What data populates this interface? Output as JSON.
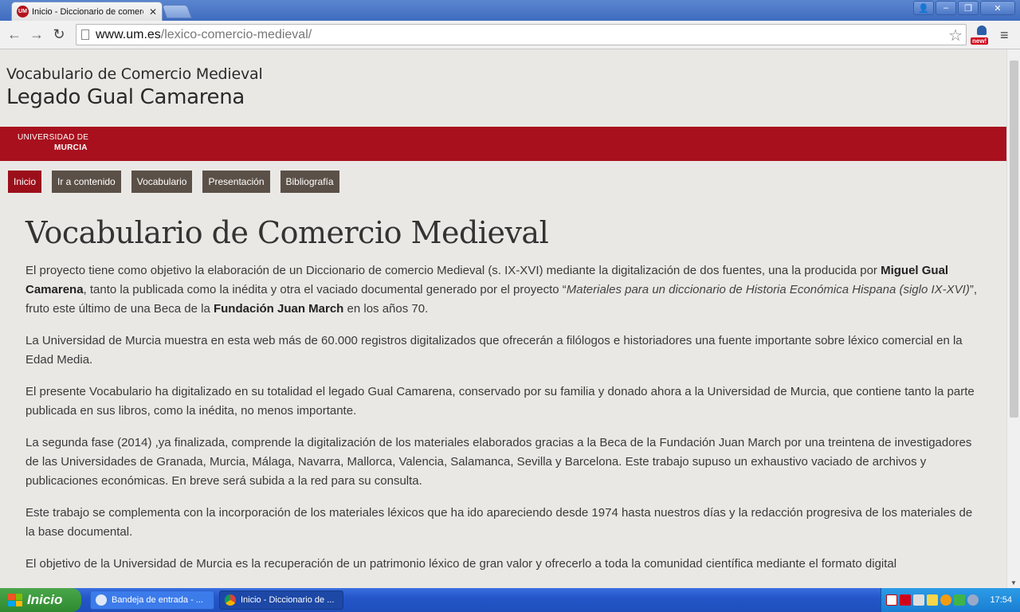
{
  "browser": {
    "tab_title": "Inicio - Diccionario de comerc",
    "tab_favicon": "UM",
    "url_host": "www.um.es",
    "url_path": "/lexico-comercio-medieval/",
    "extension_badge": "new!"
  },
  "site": {
    "subtitle": "Vocabulario de Comercio Medieval",
    "title": "Legado Gual Camarena",
    "logo_line1": "UNIVERSIDAD DE",
    "logo_line2": "MURCIA",
    "accent_color": "#a8101e"
  },
  "menu": [
    {
      "label": "Inicio",
      "active": true
    },
    {
      "label": "Ir a contenido"
    },
    {
      "label": "Vocabulario"
    },
    {
      "label": "Presentación"
    },
    {
      "label": "Bibliografía"
    }
  ],
  "content": {
    "heading": "Vocabulario de Comercio Medieval",
    "p1": {
      "a": "El proyecto tiene como objetivo la elaboración de un Diccionario de comercio Medieval (s. IX-XVI) mediante la digitalización de dos fuentes, una la producida por ",
      "b": "Miguel Gual Camarena",
      "c": ", tanto la publicada como la inédita y otra el vaciado documental generado por el proyecto “",
      "d": "Materiales para un diccionario de Historia Económica Hispana (siglo IX-XVI)",
      "e": "”, fruto este último de una Beca de la ",
      "f": "Fundación Juan March",
      "g": " en los años 70."
    },
    "p2": "La Universidad de Murcia muestra en esta web más de 60.000 registros digitalizados que ofrecerán a filólogos e historiadores una fuente importante sobre léxico comercial en la Edad Media.",
    "p3": "El presente Vocabulario ha digitalizado en su totalidad el legado Gual Camarena, conservado por su familia y donado ahora a la Universidad de Murcia, que contiene tanto la parte publicada en sus libros, como la inédita, no menos importante.",
    "p4": "La segunda fase (2014) ,ya finalizada, comprende la digitalización de los materiales elaborados gracias a la Beca de la Fundación Juan March por una treintena de investigadores de las Universidades de Granada, Murcia, Málaga, Navarra, Mallorca, Valencia, Salamanca, Sevilla y Barcelona. Este trabajo supuso un exhaustivo vaciado de archivos y publicaciones económicas. En breve será subida a la red para su consulta.",
    "p5": "Este trabajo se complementa con la incorporación de los materiales léxicos que ha ido apareciendo desde 1974 hasta nuestros días y la redacción progresiva de los materiales de la base documental.",
    "p6": "El objetivo de la Universidad de Murcia es la recuperación de un patrimonio léxico de gran valor y ofrecerlo a toda la comunidad científica mediante el formato digital"
  },
  "taskbar": {
    "start_label": "Inicio",
    "task1": "Bandeja de entrada - ...",
    "task2": "Inicio - Diccionario de ...",
    "clock": "17:54"
  }
}
